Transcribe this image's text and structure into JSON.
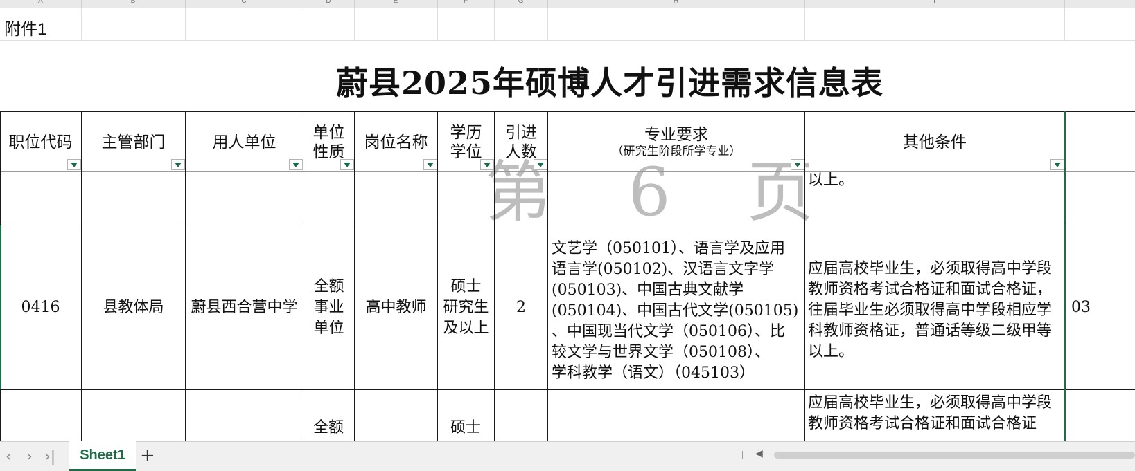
{
  "columns": [
    "A",
    "B",
    "C",
    "D",
    "E",
    "F",
    "G",
    "H",
    "I"
  ],
  "annex_label": "附件1",
  "title": "蔚县2025年硕博人才引进需求信息表",
  "headers": {
    "code": "职位代码",
    "dept": "主管部门",
    "unit": "用人单位",
    "nature_line1": "单位",
    "nature_line2": "性质",
    "post": "岗位名称",
    "edu_line1": "学历",
    "edu_line2": "学位",
    "count_line1": "引进",
    "count_line2": "人数",
    "major_main": "专业要求",
    "major_sub": "（研究生阶段所学专业）",
    "other": "其他条件"
  },
  "watermark": "第 6 页",
  "partial_row_top": {
    "other": "以上。"
  },
  "row": {
    "code": "0416",
    "dept": "县教体局",
    "unit": "蔚县西合营中学",
    "nature_l1": "全额",
    "nature_l2": "事业",
    "nature_l3": "单位",
    "post": "高中教师",
    "edu_l1": "硕士",
    "edu_l2": "研究生",
    "edu_l3": "及以上",
    "count": "2",
    "major_l1": "文艺学（050101）、语言学及应用",
    "major_l2": "语言学(050102)、汉语言文字学",
    "major_l3": "(050103)、中国古典文献学",
    "major_l4": "(050104)、中国古代文学(050105)",
    "major_l5": "、中国现当代文学（050106）、比",
    "major_l6": "较文学与世界文学（050108）、",
    "major_l7": "学科教学（语文）（045103）",
    "other_l1": "应届高校毕业生，必须取得高中学段",
    "other_l2": "教师资格考试合格证和面试合格证，",
    "other_l3": "往届毕业生必须取得高中学段相应学",
    "other_l4": "科教师资格证，普通话等级二级甲等",
    "other_l5": "以上。",
    "next_col_code": "03"
  },
  "partial_row_bottom": {
    "nature": "全额",
    "edu": "硕士",
    "other_l1": "应届高校毕业生，必须取得高中学段",
    "other_l2": "教师资格考试合格证和面试合格证"
  },
  "sheet_tab": "Sheet1",
  "nav": {
    "first": "‹",
    "prev": "›",
    "last": "›|",
    "add": "+"
  },
  "colors": {
    "accent": "#1e6b48"
  }
}
